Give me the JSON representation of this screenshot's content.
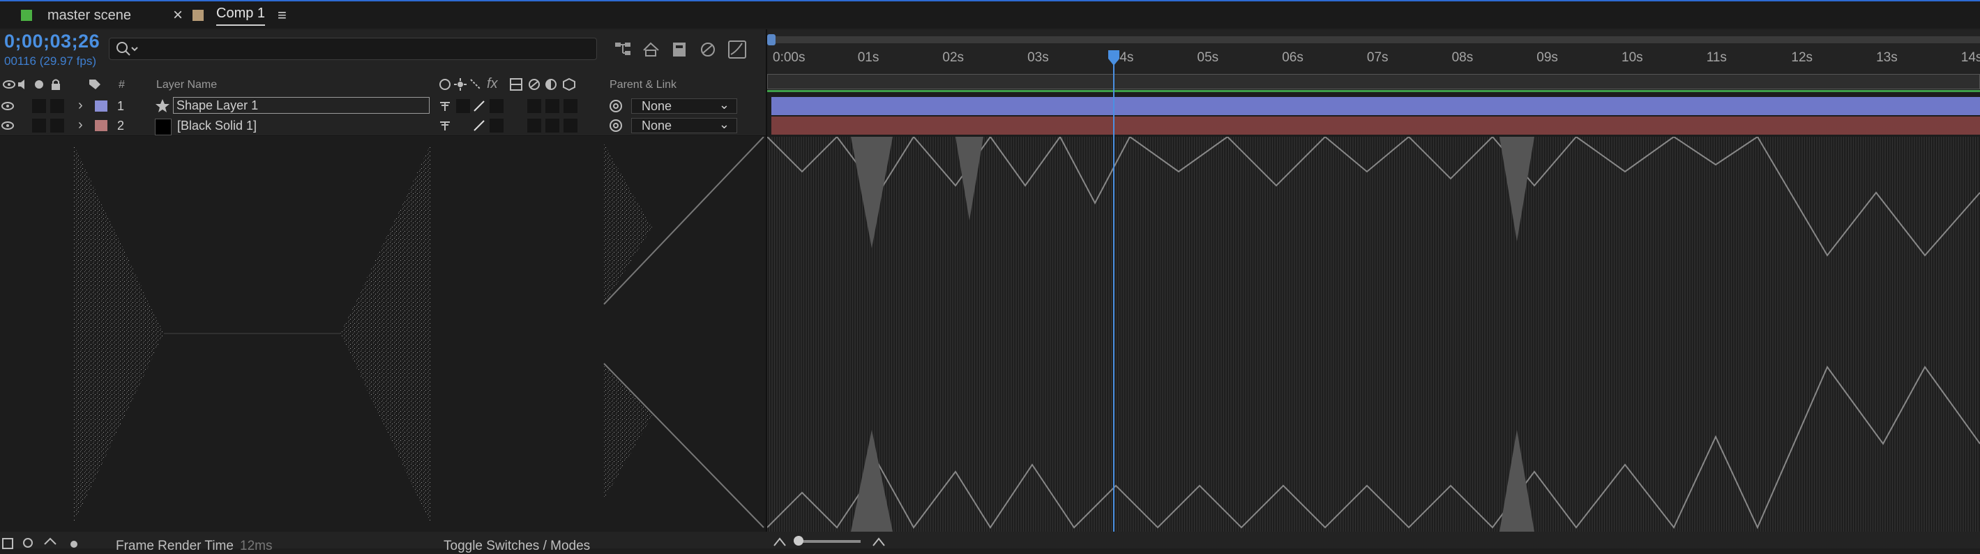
{
  "tabs": [
    {
      "label": "master scene",
      "color": "#4bb043"
    },
    {
      "label": "Comp 1",
      "color": "#b59a76"
    }
  ],
  "tab_close_icon": "×",
  "tab_menu_icon": "≡",
  "timeline": {
    "timecode": "0;00;03;26",
    "frame_info": "00116 (29.97 fps)",
    "search_placeholder": "",
    "ruler_ticks": [
      "0:00s",
      "01s",
      "02s",
      "03s",
      "04s",
      "05s",
      "06s",
      "07s",
      "08s",
      "09s",
      "10s",
      "11s",
      "12s",
      "13s",
      "14s"
    ],
    "playhead_seconds": 3.87
  },
  "columns": {
    "layer_name": "Layer Name",
    "parent_link": "Parent & Link",
    "hash": "#"
  },
  "layers": [
    {
      "index": "1",
      "name": "Shape Layer 1",
      "label_color": "#8a8fd6",
      "parent": "None",
      "bar_color": "#6f78c9",
      "type_icon": "star-icon"
    },
    {
      "index": "2",
      "name": "[Black Solid 1]",
      "label_color": "#b77a7a",
      "parent": "None",
      "bar_color": "#7a3e3e",
      "type_icon": "solid-icon"
    }
  ],
  "status_bar": {
    "frame_render_label": "Frame Render Time",
    "frame_render_value": "12ms",
    "toggle_label": "Toggle Switches / Modes"
  },
  "colors": {
    "accent": "#4a90e2",
    "background": "#1d1d1d"
  }
}
